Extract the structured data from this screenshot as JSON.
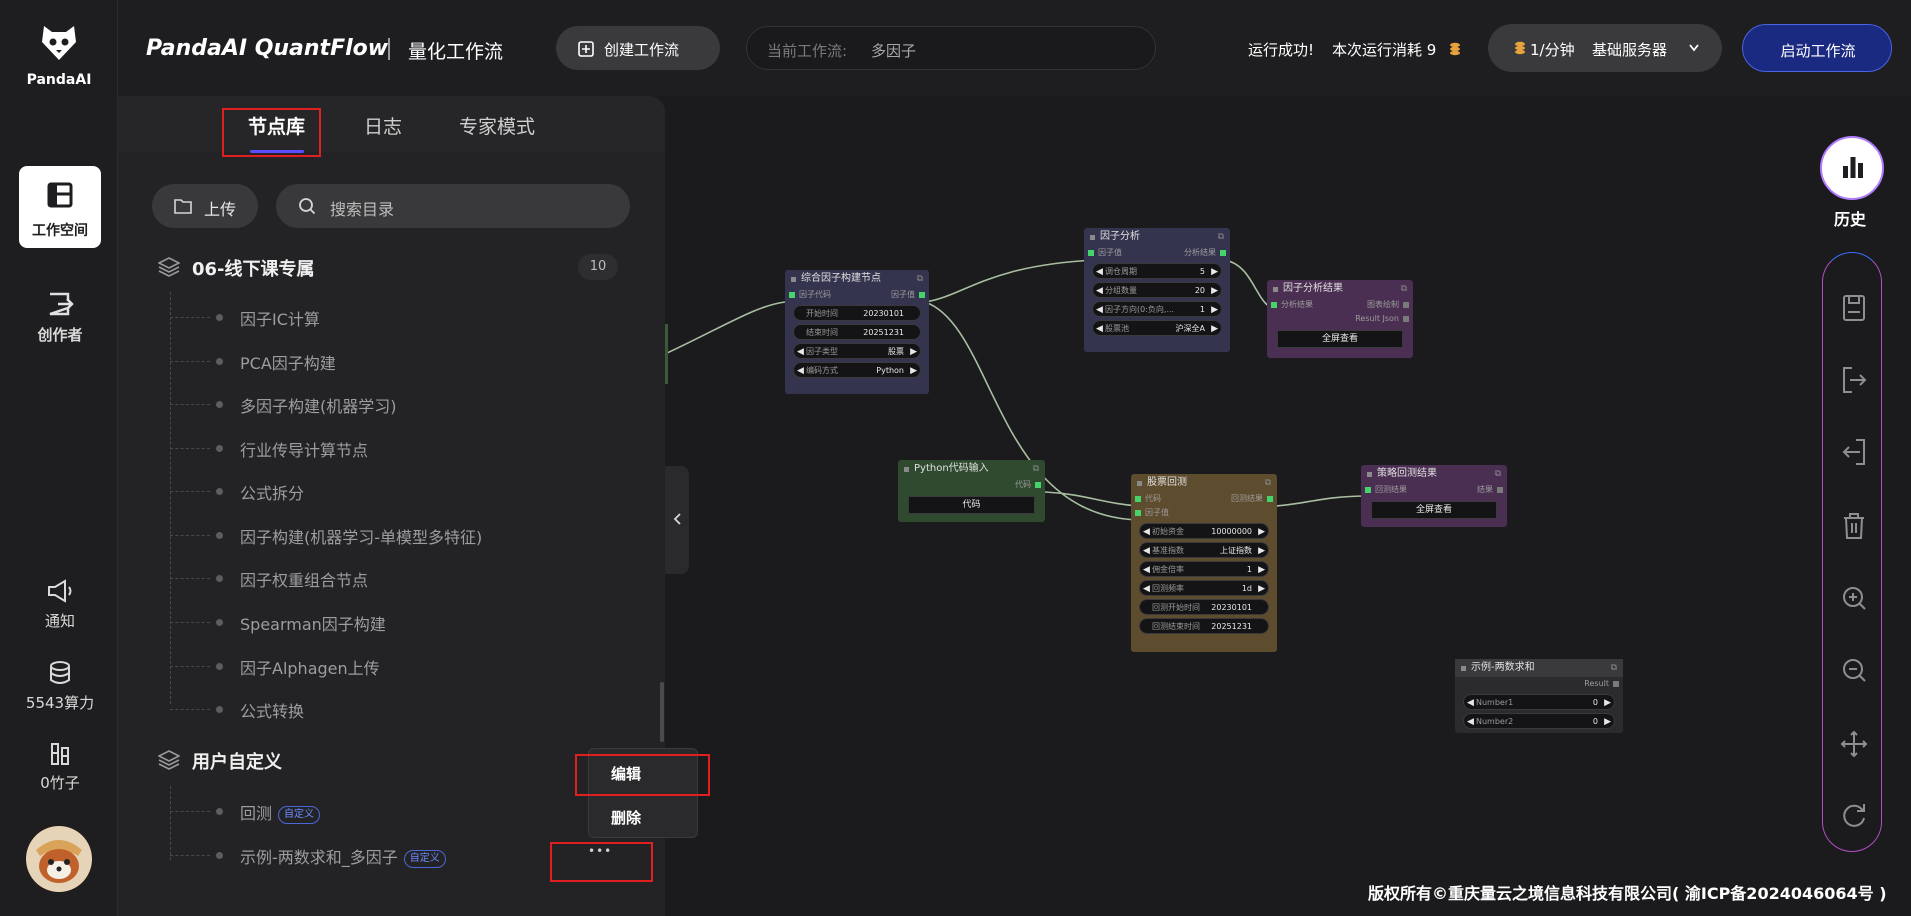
{
  "rail": {
    "logo_text": "PandaAI",
    "workspace_label": "工作空间",
    "creator_label": "创作者",
    "notify_label": "通知",
    "compute_label": "5543算力",
    "bamboo_label": "0竹子"
  },
  "header": {
    "brand": "PandaAI QuantFlow",
    "subtitle": "量化工作流",
    "create_button": "创建工作流",
    "current_label": "当前工作流:",
    "current_value": "多因子",
    "status_text": "运行成功!",
    "cost_text": "本次运行消耗 9",
    "rate_text": "1/分钟",
    "server_text": "基础服务器",
    "start_button": "启动工作流"
  },
  "panel": {
    "tabs": [
      "节点库",
      "日志",
      "专家模式"
    ],
    "upload_label": "上传",
    "search_placeholder": "搜索目录",
    "group1": {
      "title": "06-线下课专属",
      "count": "10"
    },
    "group1_items": [
      "因子IC计算",
      "PCA因子构建",
      "多因子构建(机器学习)",
      "行业传导计算节点",
      "公式拆分",
      "因子构建(机器学习-单模型多特征)",
      "因子权重组合节点",
      "Spearman因子构建",
      "因子Alphagen上传",
      "公式转换"
    ],
    "group2": {
      "title": "用户自定义"
    },
    "group2_items": [
      {
        "label": "回测",
        "tag": "自定义"
      },
      {
        "label": "示例-两数求和_多因子",
        "tag": "自定义"
      }
    ],
    "more_label": "•••",
    "context_menu": {
      "edit": "编辑",
      "delete": "删除"
    }
  },
  "nodes": {
    "factor_build": {
      "title": "综合因子构建节点",
      "in_port": "因子代码",
      "out_port": "因子值",
      "fields": [
        {
          "label": "开始时间",
          "value": "20230101"
        },
        {
          "label": "结束时间",
          "value": "20251231"
        },
        {
          "label": "因子类型",
          "value": "股票"
        },
        {
          "label": "编码方式",
          "value": "Python"
        }
      ]
    },
    "factor_analysis": {
      "title": "因子分析",
      "in_port": "因子值",
      "out_port": "分析结果",
      "fields": [
        {
          "label": "调仓周期",
          "value": "5"
        },
        {
          "label": "分组数量",
          "value": "20"
        },
        {
          "label": "因子方向(0:负向,...",
          "value": "1"
        },
        {
          "label": "股票池",
          "value": "沪深全A"
        }
      ]
    },
    "factor_result": {
      "title": "因子分析结果",
      "in_port": "分析结果",
      "out_port1": "图表绘制",
      "out_port2": "Result Json",
      "button": "全屏查看"
    },
    "python_input": {
      "title": "Python代码输入",
      "out_port": "代码",
      "button": "代码"
    },
    "backtest": {
      "title": "股票回测",
      "in_port1": "代码",
      "in_port2": "因子值",
      "out_port": "回测结果",
      "fields": [
        {
          "label": "初始资金",
          "value": "10000000"
        },
        {
          "label": "基准指数",
          "value": "上证指数"
        },
        {
          "label": "佣金倍率",
          "value": "1"
        },
        {
          "label": "回测频率",
          "value": "1d"
        },
        {
          "label": "回测开始时间",
          "value": "20230101"
        },
        {
          "label": "回测结束时间",
          "value": "20251231"
        }
      ]
    },
    "strategy_result": {
      "title": "策略回测结果",
      "in_port": "回测结果",
      "out_port": "结果",
      "button": "全屏查看"
    },
    "sum_example": {
      "title": "示例-两数求和",
      "out_port": "Result",
      "fields": [
        {
          "label": "Number1",
          "value": "0"
        },
        {
          "label": "Number2",
          "value": "0"
        }
      ]
    }
  },
  "toolbar": {
    "history_label": "历史"
  },
  "footer": {
    "copyright": "版权所有©重庆量云之境信息科技有限公司( 渝ICP备2024046064号 )"
  },
  "colors": {
    "accent": "#5b7cff",
    "highlight_box": "#e02020",
    "port": "#45d46b"
  }
}
